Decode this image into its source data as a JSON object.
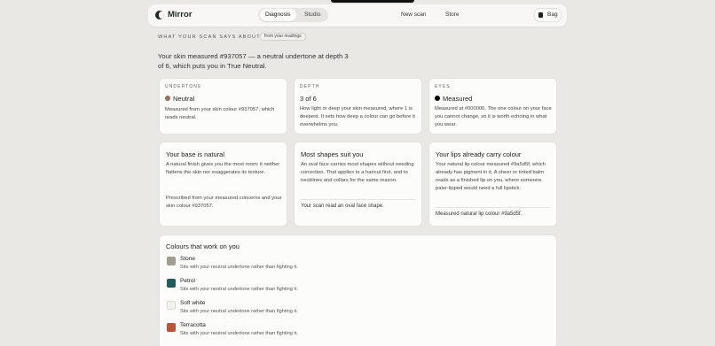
{
  "header": {
    "brand": "Mirror",
    "tabs": [
      {
        "label": "Diagnosis",
        "active": true
      },
      {
        "label": "Studio",
        "active": false
      }
    ],
    "nav": [
      "New scan",
      "Store"
    ],
    "bag_label": "Bag"
  },
  "section": {
    "overline": "What your scan says about you",
    "chip": "from your readings",
    "summary": "Your skin measured #937057 — a neutral undertone at depth 3 of 6, which puts you in True Neutral."
  },
  "metrics": [
    {
      "overline": "Undertone",
      "title": "Neutral",
      "dot": "#937057",
      "body": "Measured from your skin colour #937057, which reads neutral."
    },
    {
      "overline": "Depth",
      "title": "3 of 6",
      "body": "How light or deep your skin measured, where 1 is deepest. It sets how deep a colour can go before it overwhelms you."
    },
    {
      "overline": "Eyes",
      "title": "Measured",
      "dot": "#000000",
      "body": "Measured at #000000. The one colour on your face you cannot change, so it is worth echoing in what you wear."
    }
  ],
  "advice": [
    {
      "title": "Your base is natural",
      "body": "A natural finish gives you the most room: it neither flattens the skin nor exaggerates its texture.",
      "body2": "Prescribed from your measured concerns and your skin colour #937057."
    },
    {
      "title": "Most shapes suit you",
      "body": "An oval face carries most shapes without needing correction. That applies to a haircut first, and to necklines and collars for the same reason.",
      "foot": "Your scan read an oval face shape."
    },
    {
      "title": "Your lips already carry colour",
      "body": "Your natural lip colour measured #9a5d5f, which already has pigment in it. A sheer or tinted balm reads as a finished lip on you, where someone paler-lipped would need a full lipstick.",
      "foot": "Measured natural lip colour #9a5d5f."
    }
  ],
  "colours": {
    "title": "Colours that work on you",
    "items": [
      {
        "name": "Stone",
        "swatch": "#a39c91",
        "desc": "Sits with your neutral undertone rather than fighting it."
      },
      {
        "name": "Petrol",
        "swatch": "#235a5c",
        "desc": "Sits with your neutral undertone rather than fighting it."
      },
      {
        "name": "Soft white",
        "swatch": "#f3f1ec",
        "desc": "Sits with your neutral undertone rather than fighting it."
      },
      {
        "name": "Terracotta",
        "swatch": "#b9533b",
        "desc": "Sits with your neutral undertone rather than fighting it."
      }
    ]
  }
}
